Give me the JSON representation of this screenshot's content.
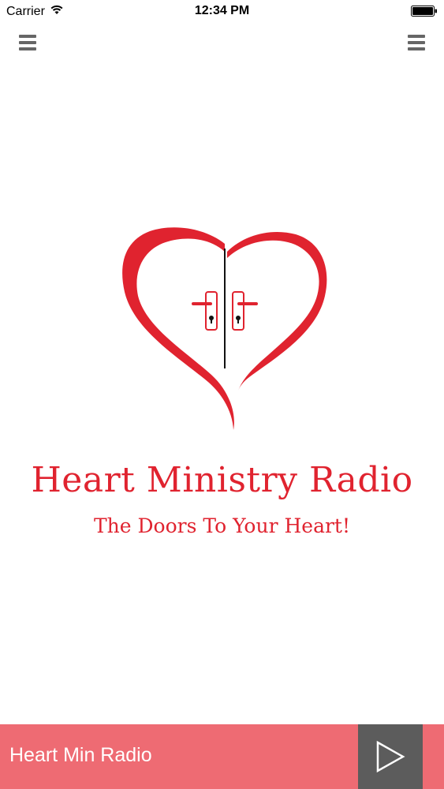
{
  "status_bar": {
    "carrier": "Carrier",
    "time": "12:34 PM",
    "icons": {
      "wifi": "wifi-icon",
      "battery": "battery-icon"
    }
  },
  "header": {
    "left_icon": "hamburger-menu-icon",
    "right_icon": "hamburger-menu-icon"
  },
  "logo": {
    "title": "Heart Ministry Radio",
    "tagline": "The Doors To Your Heart!",
    "icon": "heart-doors-logo",
    "color": "#e0232f"
  },
  "player": {
    "station_name": "Heart Min Radio",
    "play_icon": "play-icon",
    "bar_color": "#ee6b73",
    "button_color": "#5c5c5c"
  }
}
